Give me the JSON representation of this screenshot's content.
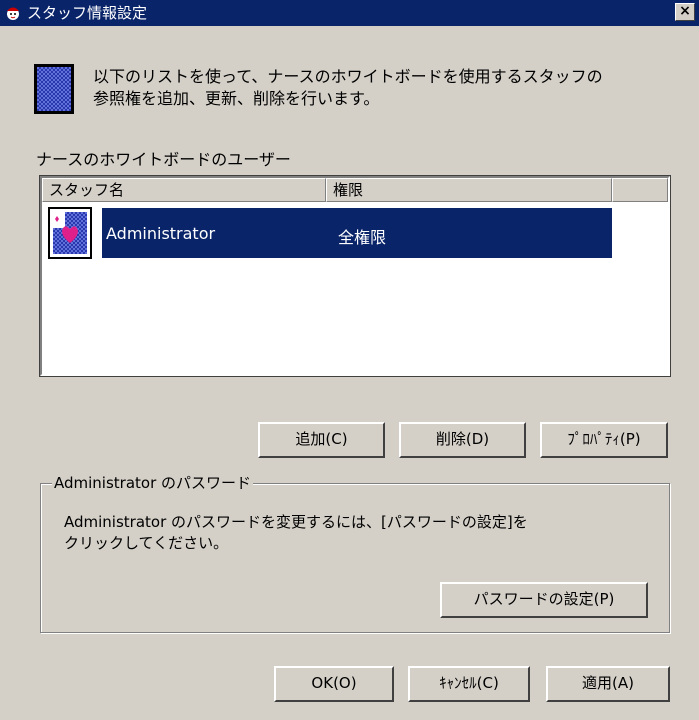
{
  "window": {
    "title": "スタッフ情報設定",
    "close_label": "×"
  },
  "description": {
    "line1": "以下のリストを使って、ナースのホワイトボードを使用するスタッフの",
    "line2": "参照権を追加、更新、削除を行います。"
  },
  "users_group": {
    "label": "ナースのホワイトボードのユーザー",
    "columns": [
      "スタッフ名",
      "権限"
    ],
    "rows": [
      {
        "name": "Administrator",
        "permission": "全権限",
        "selected": true
      }
    ]
  },
  "list_buttons": {
    "add": "追加(C)",
    "delete": "削除(D)",
    "properties": "ﾌﾟﾛﾊﾟﾃｨ(P)"
  },
  "password_group": {
    "legend": "Administrator のパスワード",
    "text_line1": "Administrator のパスワードを変更するには、[パスワードの設定]を",
    "text_line2": "クリックしてください。",
    "set_password": "パスワードの設定(P)"
  },
  "dialog_buttons": {
    "ok": "OK(O)",
    "cancel": "ｷｬﾝｾﾙ(C)",
    "apply": "適用(A)"
  },
  "colors": {
    "titlebar": "#0a246a",
    "selection": "#0a246a",
    "face": "#d4d0c8"
  },
  "icons": {
    "title": "app-icon",
    "info": "whiteboard-icon",
    "row": "user-card-icon"
  }
}
